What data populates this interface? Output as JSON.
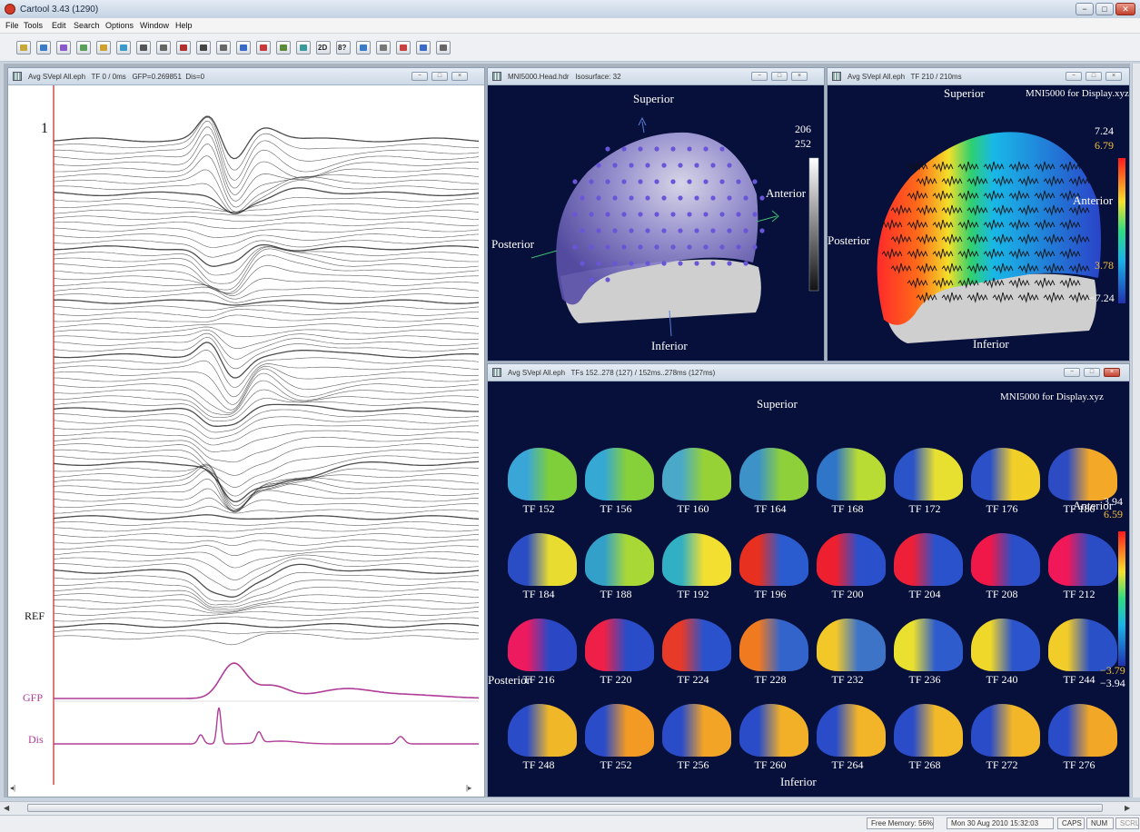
{
  "app": {
    "title": "Cartool 3.43 (1290)",
    "buttons": {
      "minimize": "−",
      "maximize": "□",
      "close": "✕"
    }
  },
  "menu": [
    "File",
    "Tools",
    "Edit",
    "Search",
    "Options",
    "Window",
    "Help"
  ],
  "toolbar": {
    "icons": [
      "new-icon",
      "undo-icon",
      "open-icon",
      "tracks-icon",
      "zoom-icon",
      "magnify-icon",
      "search-icon",
      "record-icon",
      "record-stop-icon",
      "grid-icon",
      "tracks-small-icon",
      "chart-icon",
      "globe-icon",
      "users-icon",
      "wave-icon",
      "2d-icon",
      "question-icon",
      "spread-icon",
      "dots-icon",
      "monitor-icon",
      "display-icon",
      "erase-icon"
    ],
    "labels": [
      "",
      "",
      "",
      "",
      "",
      "",
      "",
      "",
      "",
      "",
      "",
      "",
      "",
      "",
      "",
      "2D",
      "8?",
      "",
      "",
      "",
      "",
      ""
    ]
  },
  "colors": {
    "panel_bg": "#07103a",
    "trace": "#2b2b2b",
    "gfp": "#b03c98",
    "accent_yellow": "#f0c040",
    "ref_line": "#c62020"
  },
  "windows": {
    "eeg": {
      "title": "Avg SVepl All.eph",
      "tf": "TF 0 / 0ms",
      "gfp": "GFP=0.269851",
      "dis": "Dis=0",
      "label_top": "1",
      "label_ref": "REF",
      "label_gfp": "GFP",
      "label_dis": "Dis",
      "scroll_left": "◂|",
      "scroll_right": "|▸"
    },
    "head": {
      "title": "MNI5000.Head.hdr",
      "isosurface": "Isosurface: 32",
      "superior": "Superior",
      "inferior": "Inferior",
      "anterior": "Anterior",
      "posterior": "Posterior",
      "scale_top": "206",
      "scale_second": "252"
    },
    "map": {
      "title": "Avg SVepl All.eph",
      "tf": "TF 210 / 210ms",
      "xyz": "MNI5000 for Display.xyz",
      "superior": "Superior",
      "inferior": "Inferior",
      "anterior": "Anterior",
      "posterior": "Posterior",
      "max": "7.24",
      "max_cur": "6.79",
      "min_cur": "3.78",
      "min": "−7.24"
    },
    "series": {
      "title": "Avg SVepl All.eph",
      "range": "TFs 152..278 (127) / 152ms..278ms (127ms)",
      "xyz": "MNI5000 for Display.xyz",
      "superior": "Superior",
      "inferior": "Inferior",
      "anterior": "Anterior",
      "posterior": "Posterior",
      "scale_max": "3.94",
      "scale_max_cur": "6.59",
      "scale_min_cur": "−3.79",
      "scale_min": "−3.94",
      "frames": [
        {
          "label": "TF 152",
          "c1": "#3aa6d8",
          "c2": "#7fcf3a"
        },
        {
          "label": "TF 156",
          "c1": "#35a8d4",
          "c2": "#86d03a"
        },
        {
          "label": "TF 160",
          "c1": "#4aa9c8",
          "c2": "#96d236"
        },
        {
          "label": "TF 164",
          "c1": "#3d93c8",
          "c2": "#8ed03a"
        },
        {
          "label": "TF 168",
          "c1": "#2f76c8",
          "c2": "#b9dc34"
        },
        {
          "label": "TF 172",
          "c1": "#2a54c8",
          "c2": "#e8e030"
        },
        {
          "label": "TF 176",
          "c1": "#2c50c8",
          "c2": "#f2cf28"
        },
        {
          "label": "TF 180",
          "c1": "#2d4cc4",
          "c2": "#f4a828"
        },
        {
          "label": "TF 184",
          "c1": "#2a4dc6",
          "c2": "#e9dc30"
        },
        {
          "label": "TF 188",
          "c1": "#32a0c8",
          "c2": "#a8d836"
        },
        {
          "label": "TF 192",
          "c1": "#30b0c2",
          "c2": "#f2df30"
        },
        {
          "label": "TF 196",
          "c1": "#e83020",
          "c2": "#2a5cd0"
        },
        {
          "label": "TF 200",
          "c1": "#ee2030",
          "c2": "#2a50cc"
        },
        {
          "label": "TF 204",
          "c1": "#ee2038",
          "c2": "#2a52cc"
        },
        {
          "label": "TF 208",
          "c1": "#f01848",
          "c2": "#2a4fc8"
        },
        {
          "label": "TF 212",
          "c1": "#f01858",
          "c2": "#2a4cc4"
        },
        {
          "label": "TF 216",
          "c1": "#ee1a60",
          "c2": "#2a48c6"
        },
        {
          "label": "TF 220",
          "c1": "#ee2048",
          "c2": "#2a4cc8"
        },
        {
          "label": "TF 224",
          "c1": "#e83a28",
          "c2": "#2a52cc"
        },
        {
          "label": "TF 228",
          "c1": "#f07a20",
          "c2": "#3264cc"
        },
        {
          "label": "TF 232",
          "c1": "#f2c828",
          "c2": "#3e74c8"
        },
        {
          "label": "TF 236",
          "c1": "#eae030",
          "c2": "#2e5ccc"
        },
        {
          "label": "TF 240",
          "c1": "#f0d82a",
          "c2": "#2c54cc"
        },
        {
          "label": "TF 244",
          "c1": "#f2cc28",
          "c2": "#2a50c8"
        },
        {
          "label": "TF 248",
          "c1": "#2a4cc8",
          "c2": "#f0b828"
        },
        {
          "label": "TF 252",
          "c1": "#2a4cc8",
          "c2": "#f29a24"
        },
        {
          "label": "TF 256",
          "c1": "#2a4cc8",
          "c2": "#f2a426"
        },
        {
          "label": "TF 260",
          "c1": "#2a4cc8",
          "c2": "#f2b028"
        },
        {
          "label": "TF 264",
          "c1": "#2a4cc8",
          "c2": "#f2b428"
        },
        {
          "label": "TF 268",
          "c1": "#2a4cc8",
          "c2": "#f2ba28"
        },
        {
          "label": "TF 272",
          "c1": "#2a4cc8",
          "c2": "#f2b628"
        },
        {
          "label": "TF 276",
          "c1": "#2a4cc8",
          "c2": "#f2a826"
        }
      ]
    }
  },
  "status": {
    "memory": "Free Memory: 56%",
    "datetime": "Mon 30 Aug 2010 15:32:03",
    "caps": "CAPS",
    "num": "NUM",
    "scrl": "SCRL"
  }
}
